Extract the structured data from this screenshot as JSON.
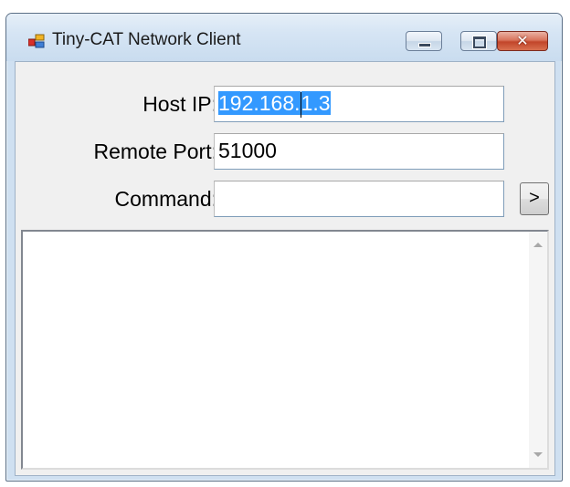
{
  "window": {
    "title": "Tiny-CAT Network Client",
    "app_icon": "app-window-icon",
    "controls": {
      "minimize_icon": "minimize-icon",
      "maximize_icon": "maximize-icon",
      "close_glyph": "✕"
    }
  },
  "form": {
    "host_ip": {
      "label": "Host IP:",
      "value_selected_part1": "192.168",
      "value_selected_part2": "1.3"
    },
    "remote_port": {
      "label": "Remote Port:",
      "value": "51000"
    },
    "command": {
      "label": "Command:",
      "value": ""
    },
    "send_button_label": ">"
  },
  "output": {
    "text": "",
    "scroll_up_icon": "scroll-up-arrow-icon",
    "scroll_down_icon": "scroll-down-arrow-icon"
  },
  "colors": {
    "selection": "#3399ff",
    "title_bar": "#d6e5f4",
    "close_button": "#c2452a"
  }
}
